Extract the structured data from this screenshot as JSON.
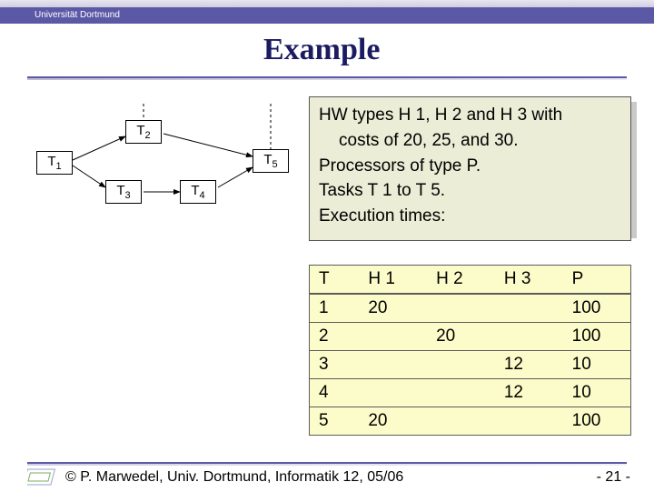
{
  "header": {
    "org": "Universität Dortmund"
  },
  "title": "Example",
  "graph": {
    "nodes": {
      "t1": {
        "main": "T",
        "sub": "1"
      },
      "t2": {
        "main": "T",
        "sub": "2"
      },
      "t3": {
        "main": "T",
        "sub": "3"
      },
      "t4": {
        "main": "T",
        "sub": "4"
      },
      "t5": {
        "main": "T",
        "sub": "5"
      }
    }
  },
  "info": {
    "line1a": "HW types H 1, H 2 and H 3 with",
    "line1b": "costs of 20, 25, and 30.",
    "line2": "Processors of type P.",
    "line3": "Tasks T 1 to T 5.",
    "line4": "Execution times:"
  },
  "table": {
    "headers": {
      "c0": "T",
      "c1": "H 1",
      "c2": "H 2",
      "c3": "H 3",
      "c4": "P"
    },
    "rows": [
      {
        "c0": "1",
        "c1": "20",
        "c2": "",
        "c3": "",
        "c4": "100"
      },
      {
        "c0": "2",
        "c1": "",
        "c2": "20",
        "c3": "",
        "c4": "100"
      },
      {
        "c0": "3",
        "c1": "",
        "c2": "",
        "c3": "12",
        "c4": "10"
      },
      {
        "c0": "4",
        "c1": "",
        "c2": "",
        "c3": "12",
        "c4": "10"
      },
      {
        "c0": "5",
        "c1": "20",
        "c2": "",
        "c3": "",
        "c4": "100"
      }
    ]
  },
  "footer": {
    "left": "© P. Marwedel, Univ. Dortmund, Informatik 12, 05/06",
    "right": "- 21 -"
  },
  "chart_data": {
    "type": "table",
    "title": "Execution times",
    "columns": [
      "T",
      "H1",
      "H2",
      "H3",
      "P"
    ],
    "rows": [
      [
        1,
        20,
        null,
        null,
        100
      ],
      [
        2,
        null,
        20,
        null,
        100
      ],
      [
        3,
        null,
        null,
        12,
        10
      ],
      [
        4,
        null,
        null,
        12,
        10
      ],
      [
        5,
        20,
        null,
        null,
        100
      ]
    ],
    "hw_costs": {
      "H1": 20,
      "H2": 25,
      "H3": 30
    }
  }
}
